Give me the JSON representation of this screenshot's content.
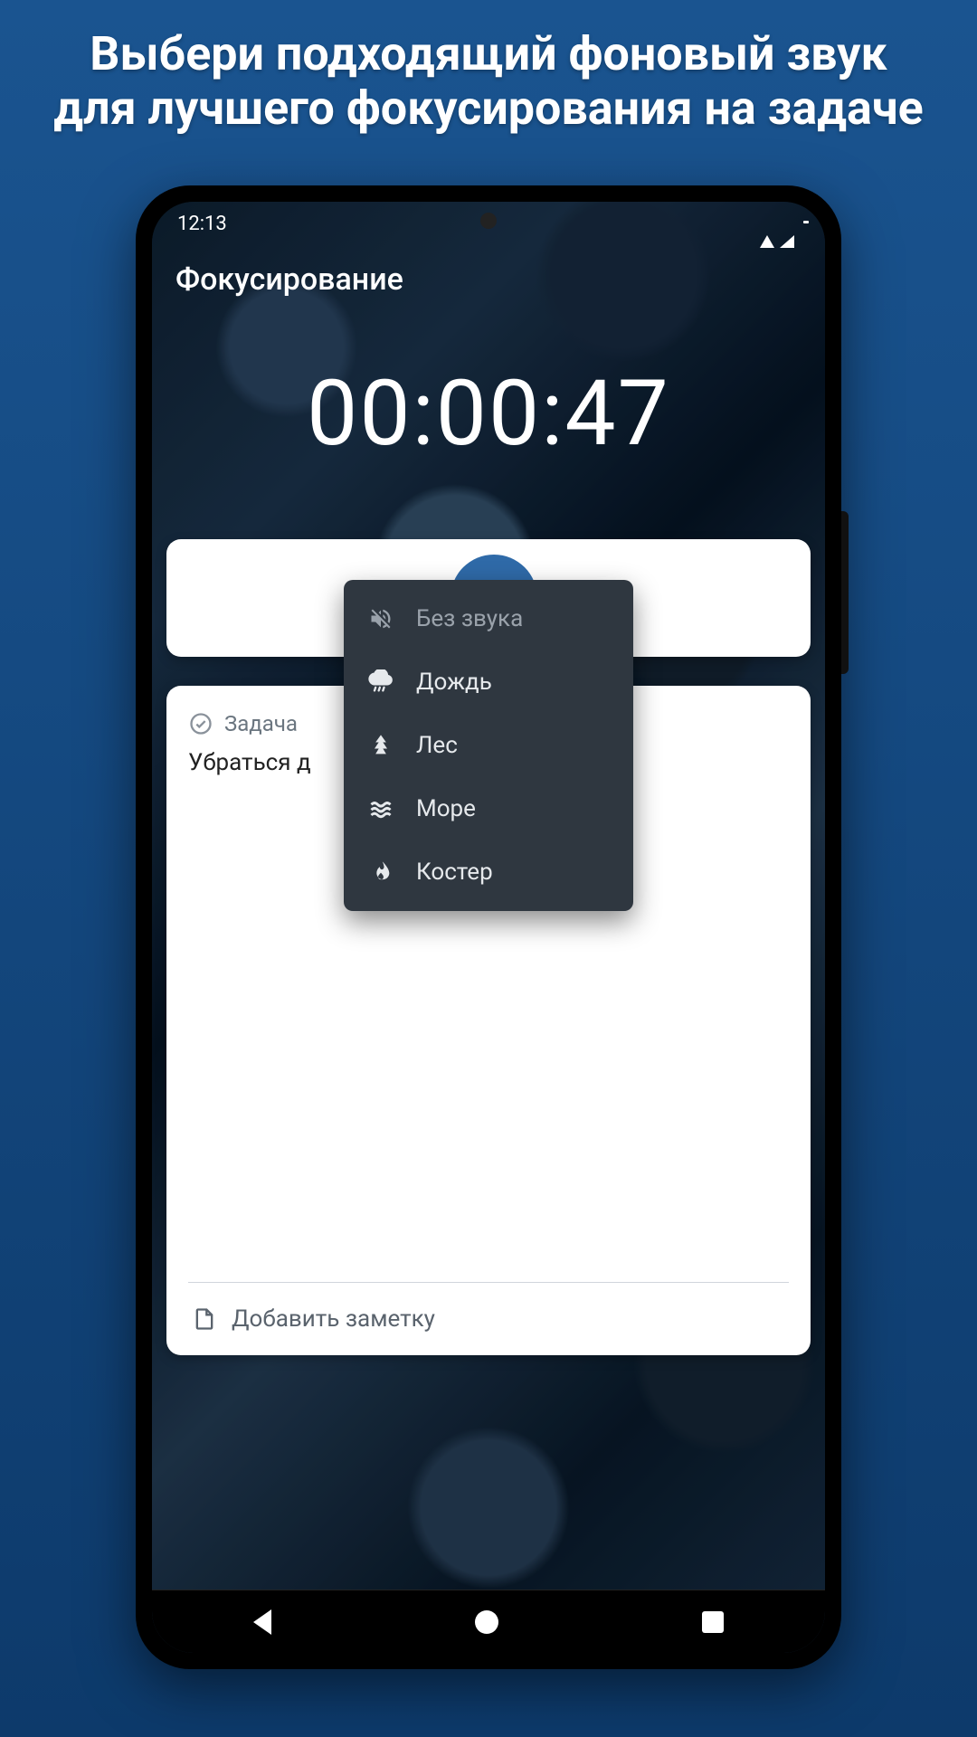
{
  "promo": {
    "headline": "Выбери подходящий фоновый звук для лучшего фокусирования на задаче"
  },
  "status": {
    "time": "12:13"
  },
  "page": {
    "title": "Фокусирование"
  },
  "timer": {
    "display": "00:00:47"
  },
  "task": {
    "section_label": "Задача",
    "text": "Убраться д",
    "note_placeholder": "Добавить заметку"
  },
  "sound_menu": {
    "items": [
      {
        "label": "Без звука",
        "icon": "mute",
        "selected": true
      },
      {
        "label": "Дождь",
        "icon": "rain",
        "selected": false
      },
      {
        "label": "Лес",
        "icon": "tree",
        "selected": false
      },
      {
        "label": "Море",
        "icon": "waves",
        "selected": false
      },
      {
        "label": "Костер",
        "icon": "fire",
        "selected": false
      }
    ]
  }
}
